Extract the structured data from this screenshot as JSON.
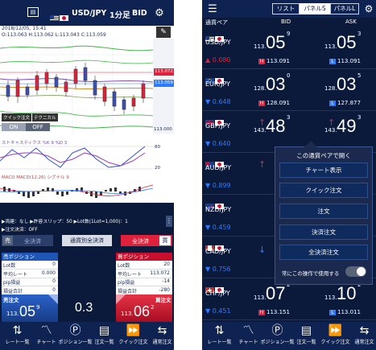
{
  "left": {
    "header": {
      "pair": "USD/JPY",
      "interval": "1分足",
      "side": "BID"
    },
    "chart_info": {
      "date": "2018/12/05, 15:41",
      "ohlc": "O:113.063   H:113.062   L:113.043   C:113.059"
    },
    "price_axis": [
      "113.072",
      "113.059",
      "113.000"
    ],
    "toggles": {
      "quick": "クイック注文",
      "technical": "テクニカル",
      "on": "ON",
      "off": "OFF"
    },
    "stoch_label": "ストキャスティクス %K 9 %D 3",
    "stoch_axis": [
      "80",
      "20"
    ],
    "macd_label": "MACD MACD(12,26) シグナル 9",
    "settings_line1": "▶両建：なし ▶許容スリップ：50 ▶Lot数(1Lot=1,000)：1",
    "settings_line2": "▶注文決済：OFF",
    "buttons": {
      "sell_all": "全決済",
      "sell_tag": "売",
      "by_pair": "通貨別全決済",
      "buy_all": "全決済",
      "buy_tag": "買"
    },
    "sell_position": {
      "title": "売ポジション",
      "rows": [
        [
          "Lot数",
          "0"
        ],
        [
          "平均レート",
          "0.000"
        ],
        [
          "pip損益",
          "0"
        ],
        [
          "損益合計",
          "0"
        ]
      ]
    },
    "buy_position": {
      "title": "買ポジション",
      "rows": [
        [
          "Lot数",
          "20"
        ],
        [
          "平均レート",
          "113.072"
        ],
        [
          "pip損益",
          "-14"
        ],
        [
          "損益合計",
          "-280"
        ]
      ]
    },
    "sell_order": {
      "label": "売注文",
      "pre": "113.",
      "big": "05",
      "sup": "9"
    },
    "spread": "0.3",
    "buy_order": {
      "label": "買注文",
      "pre": "113.",
      "big": "06",
      "sup": "2"
    },
    "nav": [
      "レート一覧",
      "チャート",
      "ポジション一覧",
      "注文一覧",
      "クイック注文",
      "通常注文"
    ]
  },
  "right": {
    "tabs": [
      "リスト",
      "パネルS",
      "パネルL"
    ],
    "active_tab": "パネルS",
    "col_pair": "通貨ペア",
    "col_bid": "BID",
    "col_ask": "ASK",
    "rows": [
      {
        "sym": "USD/JPY",
        "chg": "▲ 0.080",
        "bid_pre": "113.",
        "bid_big": "05",
        "bid_sup": "9",
        "ask_pre": "113.",
        "ask_big": "05",
        "ask_sup": "3",
        "h": "113.091",
        "l": "113.091"
      },
      {
        "sym": "EUR/JPY",
        "chg": "▼ 0.648",
        "bid_pre": "128.",
        "bid_big": "03",
        "bid_sup": "0",
        "ask_pre": "128.",
        "ask_big": "03",
        "ask_sup": "5",
        "h": "128.091",
        "l": "127.877"
      },
      {
        "sym": "GBP/JPY",
        "chg": "▼ 0.640",
        "bid_pre": "143.",
        "bid_big": "48",
        "bid_sup": "3",
        "ask_pre": "143.",
        "ask_big": "49",
        "ask_sup": "3",
        "h": "",
        "l": ""
      },
      {
        "sym": "AUD/JPY",
        "chg": "▼ 0.899",
        "bid_pre": "",
        "bid_big": "",
        "bid_sup": "",
        "ask_pre": "",
        "ask_big": "",
        "ask_sup": "",
        "h": "",
        "l": ""
      },
      {
        "sym": "NZD/JPY",
        "chg": "▼ 0.459",
        "bid_pre": "",
        "bid_big": "",
        "bid_sup": "",
        "ask_pre": "",
        "ask_big": "",
        "ask_sup": "",
        "h": "",
        "l": ""
      },
      {
        "sym": "CAD/JPY",
        "chg": "▼ 0.756",
        "bid_pre": "",
        "bid_big": "",
        "bid_sup": "",
        "ask_pre": "",
        "ask_big": "",
        "ask_sup": "",
        "h": "",
        "l": ""
      },
      {
        "sym": "CHF/JPY",
        "chg": "▼ 0.451",
        "bid_pre": "113.",
        "bid_big": "07",
        "bid_sup": "2",
        "ask_pre": "113.",
        "ask_big": "10",
        "ask_sup": "2",
        "h": "113.151",
        "l": "113.011"
      }
    ],
    "popup": {
      "title": "この通貨ペアで開く",
      "items": [
        "チャート表示",
        "クイック注文",
        "注文",
        "決済注文",
        "全決済注文"
      ],
      "toggle_label": "常にこの操作で使用する"
    },
    "nav": [
      "レート一覧",
      "チャート",
      "ポジション一覧",
      "注文一覧",
      "クイック注文",
      "通常注文"
    ]
  },
  "colors": {
    "navy": "#0b1a3a",
    "header": "#0e2352",
    "up_red": "#e0213b",
    "down_blue": "#2f7bff",
    "sell_blue": "#1e56b8",
    "buy_red": "#c8102e"
  }
}
